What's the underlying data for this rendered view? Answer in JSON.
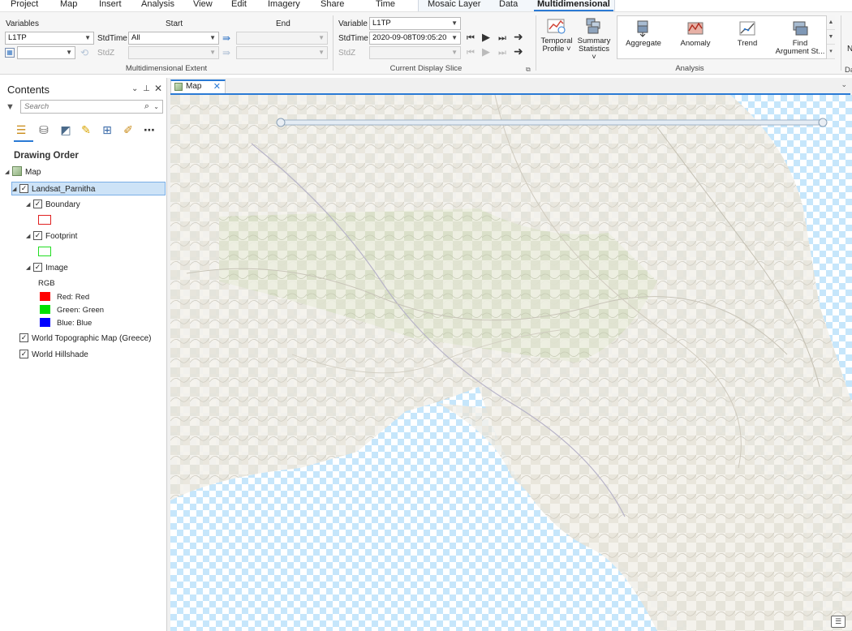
{
  "menu": {
    "tabs": [
      "Project",
      "Map",
      "Insert",
      "Analysis",
      "View",
      "Edit",
      "Imagery",
      "Share",
      "Time",
      "Mosaic Layer",
      "Data",
      "Multidimensional"
    ],
    "active": "Multidimensional"
  },
  "ribbon": {
    "extent": {
      "variables_label": "Variables",
      "start_label": "Start",
      "end_label": "End",
      "variable_value": "L1TP",
      "stdtime_label": "StdTime",
      "stdtime_value": "All",
      "stdz_label": "StdZ",
      "group_label": "Multidimensional Extent"
    },
    "slice": {
      "variable_label": "Variable",
      "variable_value": "L1TP",
      "stdtime_label": "StdTime",
      "stdtime_value": "2020-09-08T09:05:20",
      "stdz_label": "StdZ",
      "group_label": "Current Display Slice"
    },
    "profile_buttons": [
      {
        "line1": "Temporal",
        "line2": "Profile ˅"
      },
      {
        "line1": "Summary",
        "line2": "Statistics ˅"
      }
    ],
    "analysis_buttons": [
      {
        "label": "Aggregate"
      },
      {
        "label": "Anomaly"
      },
      {
        "label": "Trend"
      },
      {
        "line1": "Find",
        "line2": "Argument St..."
      }
    ],
    "analysis_label": "Analysis",
    "cut_labels": [
      "N",
      "Da"
    ]
  },
  "contents": {
    "title": "Contents",
    "search_placeholder": "Search",
    "drawing_order": "Drawing Order",
    "tree": {
      "map": "Map",
      "layer": "Landsat_Parnitha",
      "boundary": "Boundary",
      "footprint": "Footprint",
      "image": "Image",
      "rgb": "RGB",
      "red": "Red:  Red",
      "green": "Green: Green",
      "blue": "Blue:  Blue",
      "topo": "World Topographic Map (Greece)",
      "hillshade": "World Hillshade"
    },
    "colors": {
      "boundary": "#e02020",
      "footprint": "#22dd22",
      "red": "#ff0000",
      "green": "#00e000",
      "blue": "#0000ff"
    }
  },
  "mapview": {
    "tab_label": "Map"
  }
}
